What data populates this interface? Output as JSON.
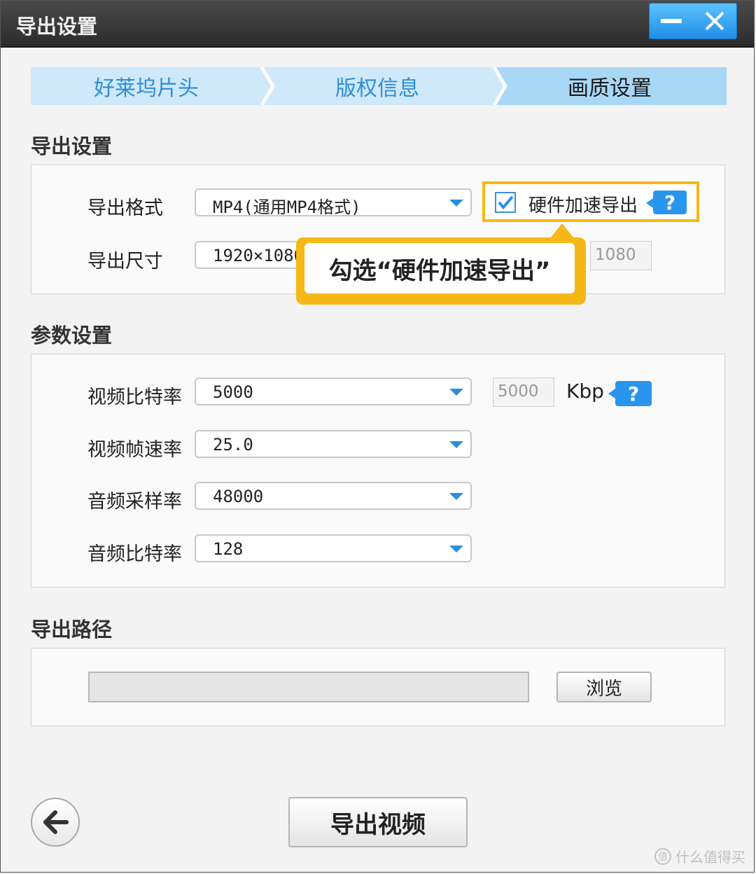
{
  "window": {
    "title": "导出设置"
  },
  "steps": [
    {
      "label": "好莱坞片头"
    },
    {
      "label": "版权信息"
    },
    {
      "label": "画质设置"
    }
  ],
  "export_settings": {
    "section_title": "导出设置",
    "format_label": "导出格式",
    "format_value": "MP4(通用MP4格式)",
    "hardware_accel_label": "硬件加速导出",
    "hardware_accel_checked": true,
    "size_label": "导出尺寸",
    "size_value": "1920×1080",
    "height_value": "1080"
  },
  "callout": {
    "text": "勾选“硬件加速导出”"
  },
  "params": {
    "section_title": "参数设置",
    "rows": [
      {
        "label": "视频比特率",
        "value": "5000"
      },
      {
        "label": "视频帧速率",
        "value": "25.0"
      },
      {
        "label": "音频采样率",
        "value": "48000"
      },
      {
        "label": "音频比特率",
        "value": "128"
      }
    ],
    "bitrate_input": "5000",
    "bitrate_unit": "Kbp"
  },
  "output_path": {
    "section_title": "导出路径",
    "path_value": "",
    "browse_label": "浏览"
  },
  "footer": {
    "export_label": "导出视频"
  },
  "help_symbol": "?",
  "watermark": {
    "text": "什么值得买",
    "icon_text": "值"
  },
  "colors": {
    "accent": "#2a95ec",
    "highlight": "#f6b817",
    "titlebar": "#333333"
  }
}
